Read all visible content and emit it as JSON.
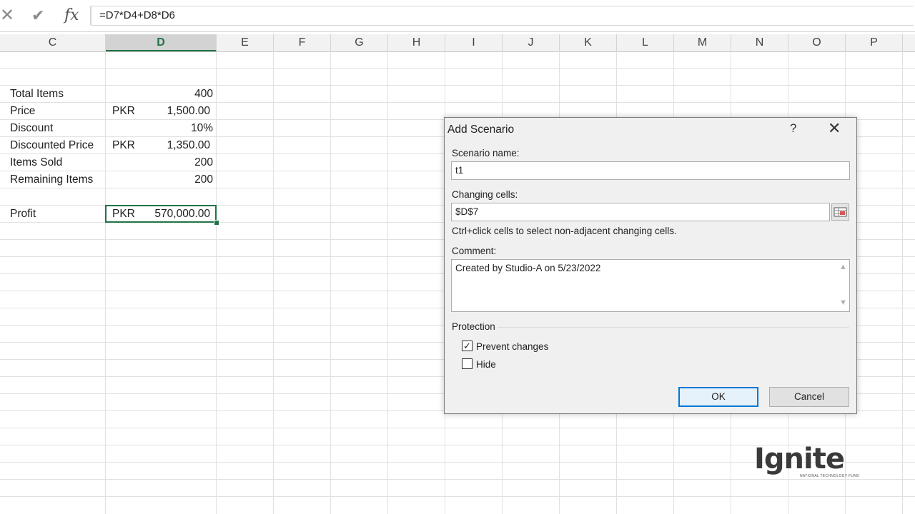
{
  "formula_bar": {
    "cancel_icon": "✕",
    "enter_icon": "✔",
    "fx_label": "fx",
    "formula": "=D7*D4+D8*D6"
  },
  "columns": [
    "C",
    "D",
    "E",
    "F",
    "G",
    "H",
    "I",
    "J",
    "K",
    "L",
    "M",
    "N",
    "O",
    "P"
  ],
  "active_column": "D",
  "rows": [
    {
      "label": "Total Items",
      "currency": "",
      "value": "400"
    },
    {
      "label": "Price",
      "currency": "PKR",
      "value": "1,500.00"
    },
    {
      "label": "Discount",
      "currency": "",
      "value": "10%"
    },
    {
      "label": "Discounted Price",
      "currency": "PKR",
      "value": "1,350.00"
    },
    {
      "label": "Items Sold",
      "currency": "",
      "value": "200"
    },
    {
      "label": "Remaining Items",
      "currency": "",
      "value": "200"
    },
    {
      "label": "Profit",
      "currency": "PKR",
      "value": "570,000.00"
    }
  ],
  "dialog": {
    "title": "Add Scenario",
    "help": "?",
    "close": "✕",
    "scenario_name_label": "Scenario name:",
    "scenario_name_value": "t1",
    "changing_cells_label": "Changing cells:",
    "changing_cells_value": "$D$7",
    "hint": "Ctrl+click cells to select non-adjacent changing cells.",
    "comment_label": "Comment:",
    "comment_value": "Created by Studio-A on 5/23/2022",
    "protection_label": "Protection",
    "prevent_changes_label": "Prevent changes",
    "prevent_changes_checked": true,
    "hide_label": "Hide",
    "hide_checked": false,
    "ok_label": "OK",
    "cancel_label": "Cancel"
  },
  "logo": {
    "text": "Ignite",
    "tagline": "NATIONAL TECHNOLOGY FUND",
    "accent_color": "#3a3a3a"
  },
  "colors": {
    "excel_green": "#217346",
    "focus_blue": "#0078d7"
  }
}
